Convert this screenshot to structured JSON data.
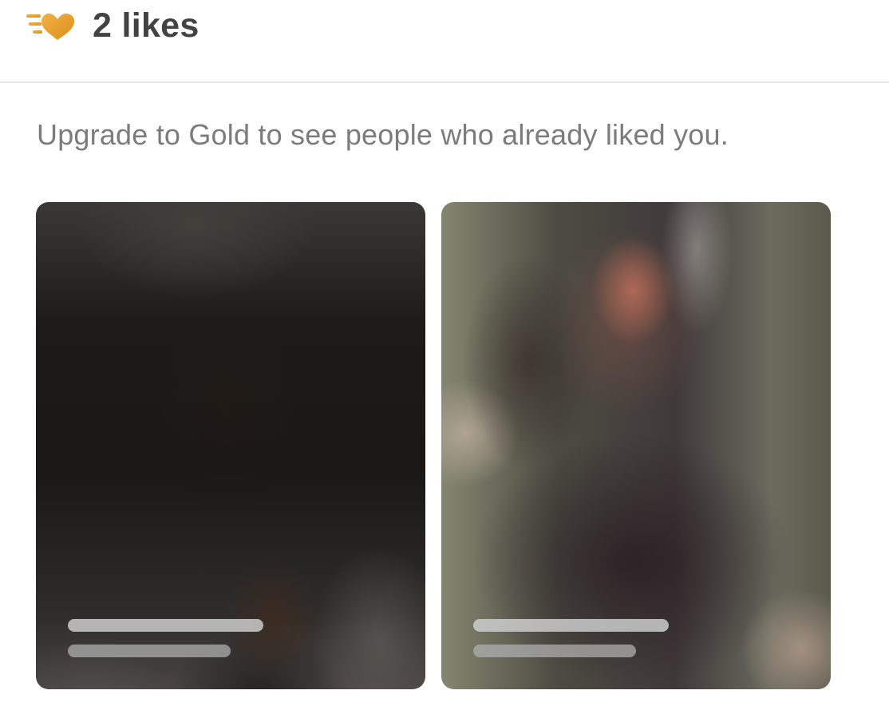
{
  "header": {
    "likes_label": "2 likes",
    "icon": "likes-heart-icon",
    "icon_color": "#E9A12C"
  },
  "subtitle": "Upgrade to Gold to see people who already liked you.",
  "cards": [
    {
      "icon": "blurred-profile-photo",
      "state": "blurred"
    },
    {
      "icon": "blurred-profile-photo",
      "state": "blurred"
    }
  ]
}
